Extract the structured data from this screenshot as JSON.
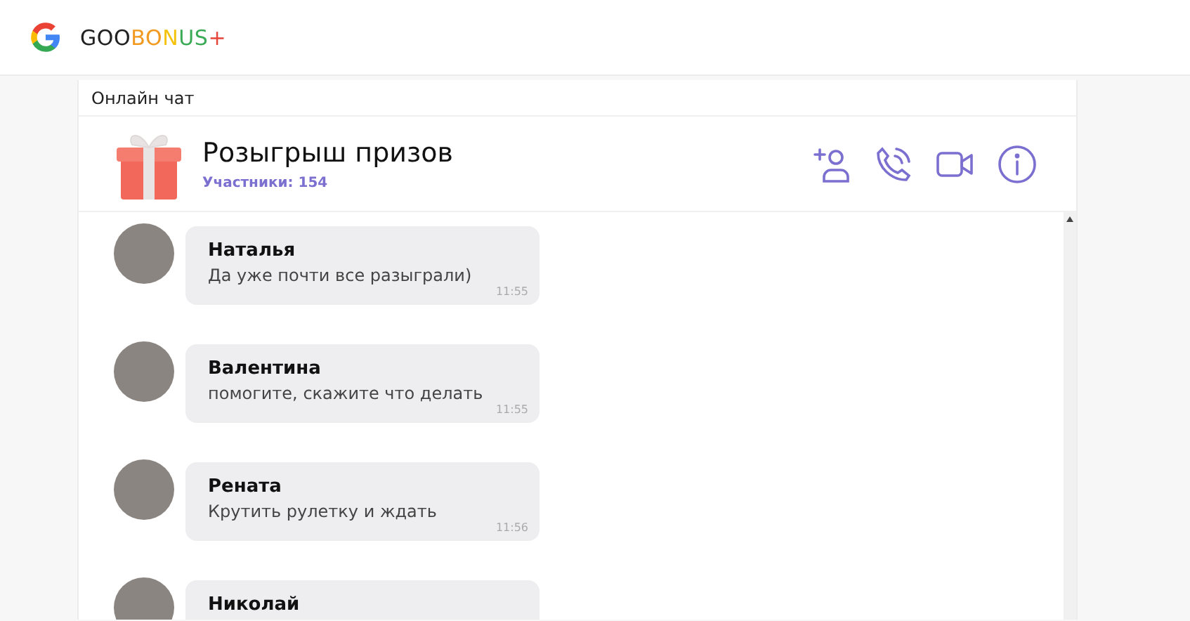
{
  "logo": {
    "parts": [
      {
        "text": "GOO",
        "color": "#222222"
      },
      {
        "text": "BO",
        "color": "#f29a1f"
      },
      {
        "text": "N",
        "color": "#f4c20d"
      },
      {
        "text": "US",
        "color": "#3aaa55"
      },
      {
        "text": "+",
        "color": "#e5463b"
      }
    ]
  },
  "chat": {
    "section_title": "Онлайн чат",
    "title": "Розыгрыш призов",
    "participants": "Участники: 154",
    "messages": [
      {
        "name": "Наталья",
        "text": "Да уже почти все разыграли)",
        "time": "11:55"
      },
      {
        "name": "Валентина",
        "text": "помогите, скажите что делать",
        "time": "11:55"
      },
      {
        "name": "Рената",
        "text": "Крутить рулетку и ждать",
        "time": "11:56"
      },
      {
        "name": "Николай"
      }
    ]
  }
}
